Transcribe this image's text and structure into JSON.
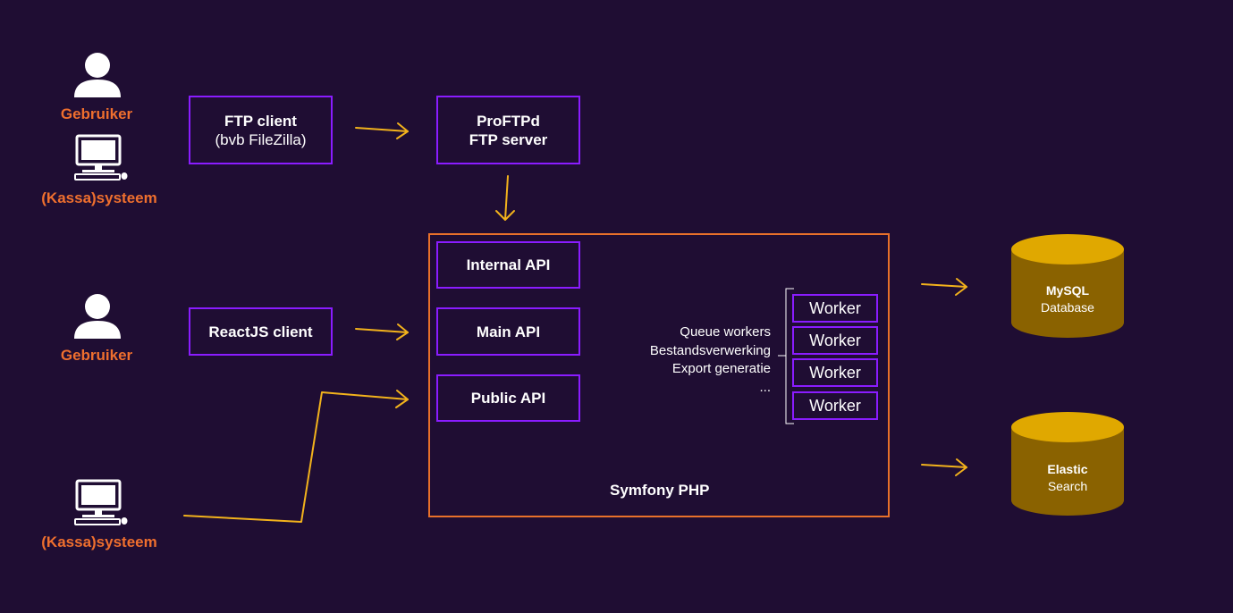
{
  "actors": [
    {
      "label": "Gebruiker",
      "icon": "user-icon"
    },
    {
      "label": "(Kassa)systeem",
      "icon": "computer-icon"
    },
    {
      "label": "Gebruiker",
      "icon": "user-icon"
    },
    {
      "label": "(Kassa)systeem",
      "icon": "computer-icon"
    }
  ],
  "clients": {
    "ftp_client": {
      "line1": "FTP client",
      "line2": "(bvb FileZilla)"
    },
    "ftp_server": {
      "line1": "ProFTPd",
      "line2": "FTP server"
    },
    "react_client": {
      "label": "ReactJS client"
    }
  },
  "symfony": {
    "label": "Symfony PHP",
    "apis": [
      "Internal API",
      "Main API",
      "Public API"
    ],
    "queue_lines": [
      "Queue workers",
      "Bestandsverwerking",
      "Export generatie",
      "..."
    ],
    "workers": [
      "Worker",
      "Worker",
      "Worker",
      "Worker"
    ]
  },
  "databases": [
    {
      "line1": "MySQL",
      "line2": "Database"
    },
    {
      "line1": "Elastic",
      "line2": "Search"
    }
  ],
  "colors": {
    "background": "#1f0d33",
    "box_border": "#8a1cff",
    "symfony_border": "#e8702a",
    "actor_label": "#ef6f2e",
    "arrow": "#f2b21c",
    "db_top": "#e0a800",
    "db_body": "#8a6200"
  }
}
